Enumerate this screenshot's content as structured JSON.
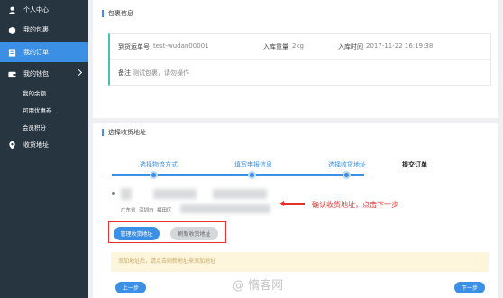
{
  "sidebar": {
    "items": [
      {
        "label": "个人中心",
        "icon": "user-icon"
      },
      {
        "label": "我的包裹",
        "icon": "package-icon"
      },
      {
        "label": "我的订单",
        "icon": "order-icon"
      },
      {
        "label": "我的钱包",
        "icon": "wallet-icon"
      },
      {
        "label": "收货地址",
        "icon": "location-icon"
      }
    ],
    "wallet_sub": [
      "我的余额",
      "可用优惠卷",
      "会员积分"
    ]
  },
  "package": {
    "section_title": "包裹信息",
    "tracking_label": "到货运单号",
    "tracking_value": "test-wudan00001",
    "weight_label": "入库重量",
    "weight_value": "2kg",
    "time_label": "入库时间",
    "time_value": "2017-11-22 16:19:38",
    "note_label": "备注",
    "note_value": "测试包裹，请勿操作"
  },
  "address": {
    "section_title": "选择收货地址",
    "steps": [
      "选择物流方式",
      "填写申报信息",
      "选择收货地址",
      "提交订单"
    ],
    "addr_province": "广东省",
    "addr_city": "深圳市",
    "addr_district": "福田区",
    "annotation": "确认收货地址，点击下一步",
    "manage_btn": "管理收货地址",
    "refresh_btn": "刷新收货地址",
    "notice": "添加地址后，请点击刷新地址来添加地址",
    "prev_btn": "上一步",
    "next_btn": "下一步"
  },
  "watermark": "@ 惰客网",
  "colors": {
    "accent": "#3b8fe4",
    "sidebar_bg": "#273541",
    "annotation_red": "#e8302b",
    "notice_bg": "#fdf6dc"
  }
}
